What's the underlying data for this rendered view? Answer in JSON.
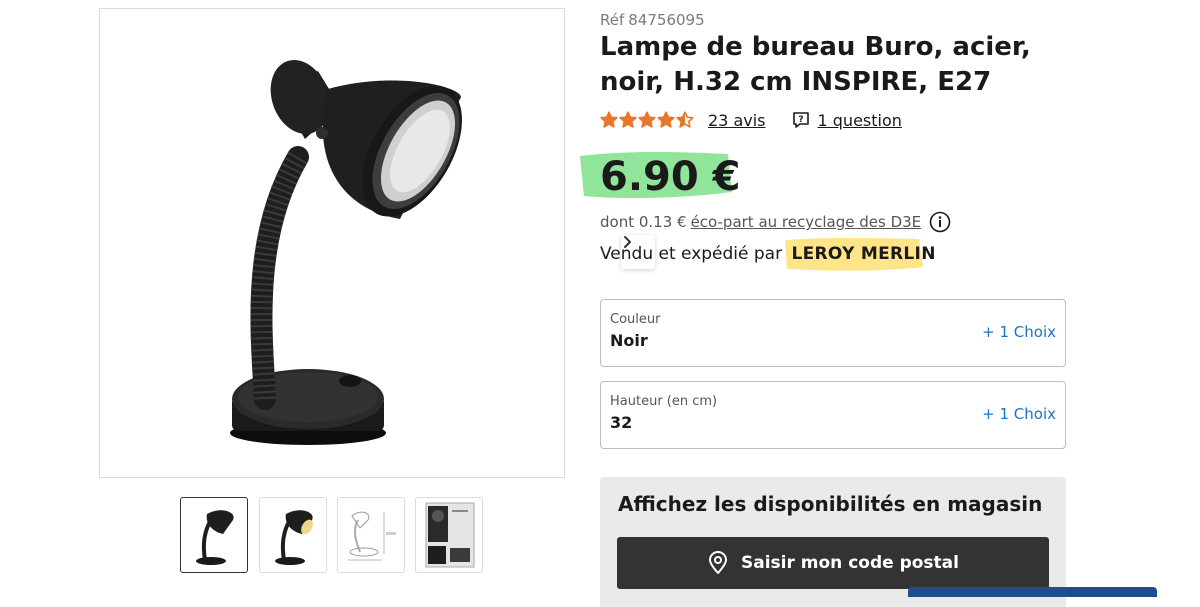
{
  "product": {
    "ref_label": "Réf",
    "ref_number": "84756095",
    "title": "Lampe de bureau Buro, acier, noir, H.32 cm INSPIRE, E27",
    "rating": 4.5,
    "rating_max": 5,
    "reviews_label": "23 avis",
    "questions_label": "1 question",
    "price": "6.90 €",
    "eco_prefix": "dont 0.13 €",
    "eco_link": "éco-part au recyclage des D3E",
    "seller_prefix": "Vendu et expédié par",
    "seller_name": "LEROY MERLIN"
  },
  "options": [
    {
      "label": "Couleur",
      "value": "Noir",
      "action": "+ 1 Choix"
    },
    {
      "label": "Hauteur (en cm)",
      "value": "32",
      "action": "+ 1 Choix"
    }
  ],
  "store": {
    "title": "Affichez les disponibilités en magasin",
    "button_label": "Saisir mon code postal"
  },
  "colors": {
    "star": "#e8762c",
    "price_highlight": "#7ee08a",
    "seller_highlight": "#ffe27a",
    "link_blue": "#1a73c7",
    "dark_button": "#333333"
  },
  "icons": {
    "next": "chevron-right-icon",
    "question": "question-bubble-icon",
    "info": "info-icon",
    "pin": "map-pin-icon"
  }
}
